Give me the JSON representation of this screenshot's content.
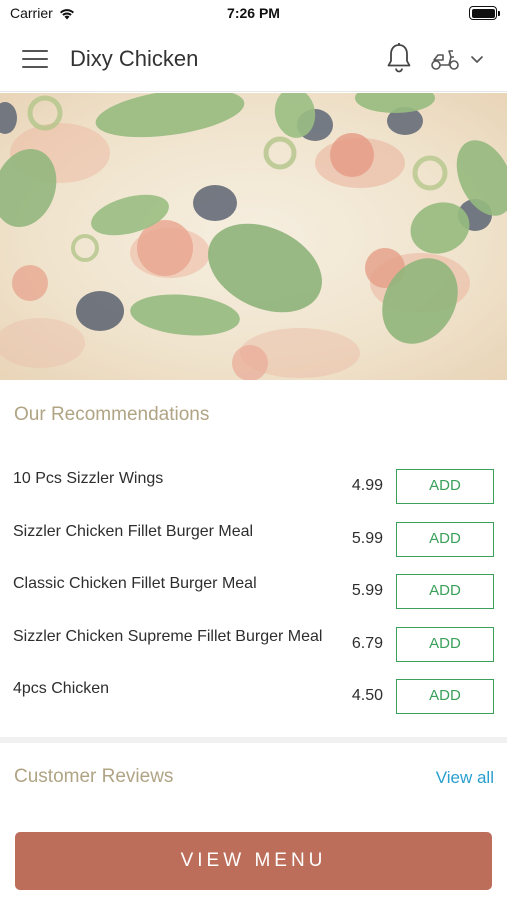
{
  "status_bar": {
    "carrier": "Carrier",
    "time": "7:26 PM"
  },
  "header": {
    "title": "Dixy Chicken",
    "menu_icon": "hamburger-icon",
    "notification_icon": "bell-icon",
    "delivery_icon": "scooter-icon",
    "dropdown_icon": "chevron-down-icon"
  },
  "recommendations": {
    "title": "Our Recommendations",
    "items": [
      {
        "name": "10 Pcs Sizzler Wings",
        "price": "4.99",
        "action": "ADD"
      },
      {
        "name": "Sizzler Chicken Fillet Burger Meal",
        "price": "5.99",
        "action": "ADD"
      },
      {
        "name": "Classic Chicken Fillet Burger Meal",
        "price": "5.99",
        "action": "ADD"
      },
      {
        "name": "Sizzler Chicken Supreme Fillet Burger Meal",
        "price": "6.79",
        "action": "ADD"
      },
      {
        "name": "4pcs Chicken",
        "price": "4.50",
        "action": "ADD"
      }
    ]
  },
  "reviews": {
    "title": "Customer Reviews",
    "link": "View all"
  },
  "footer": {
    "button_label": "VIEW MENU"
  },
  "colors": {
    "section_title": "#b0a485",
    "add_button": "#3aa05a",
    "link": "#2a9fd0",
    "primary_button": "#bd6e5a"
  }
}
